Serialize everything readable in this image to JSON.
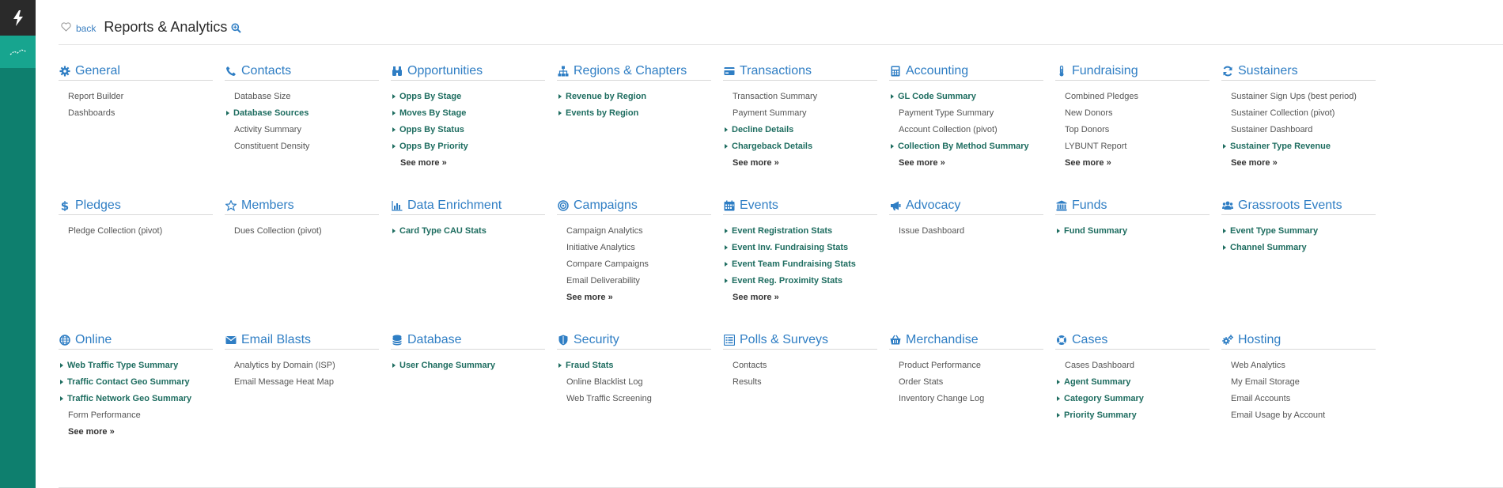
{
  "header": {
    "back_label": "back",
    "title": "Reports & Analytics"
  },
  "colors": {
    "rail": "#0e7f6e",
    "rail_active": "#17a58f",
    "accent": "#2f7ec4",
    "favorite": "#1e6d60"
  },
  "sections": [
    {
      "title": "General",
      "icon": "gear-icon",
      "items": [
        {
          "label": "Report Builder",
          "fav": false
        },
        {
          "label": "Dashboards",
          "fav": false
        }
      ],
      "see_more": ""
    },
    {
      "title": "Contacts",
      "icon": "phone-icon",
      "items": [
        {
          "label": "Database Size",
          "fav": false
        },
        {
          "label": "Database Sources",
          "fav": true
        },
        {
          "label": "Activity Summary",
          "fav": false
        },
        {
          "label": "Constituent Density",
          "fav": false
        }
      ],
      "see_more": ""
    },
    {
      "title": "Opportunities",
      "icon": "binoculars-icon",
      "items": [
        {
          "label": "Opps By Stage",
          "fav": true
        },
        {
          "label": "Moves By Stage",
          "fav": true
        },
        {
          "label": "Opps By Status",
          "fav": true
        },
        {
          "label": "Opps By Priority",
          "fav": true
        }
      ],
      "see_more": "See more »"
    },
    {
      "title": "Regions & Chapters",
      "icon": "sitemap-icon",
      "items": [
        {
          "label": "Revenue by Region",
          "fav": true
        },
        {
          "label": "Events by Region",
          "fav": true
        }
      ],
      "see_more": ""
    },
    {
      "title": "Transactions",
      "icon": "credit-card-icon",
      "items": [
        {
          "label": "Transaction Summary",
          "fav": false
        },
        {
          "label": "Payment Summary",
          "fav": false
        },
        {
          "label": "Decline Details",
          "fav": true
        },
        {
          "label": "Chargeback Details",
          "fav": true
        }
      ],
      "see_more": "See more »"
    },
    {
      "title": "Accounting",
      "icon": "calculator-icon",
      "items": [
        {
          "label": "GL Code Summary",
          "fav": true
        },
        {
          "label": "Payment Type Summary",
          "fav": false
        },
        {
          "label": "Account Collection (pivot)",
          "fav": false
        },
        {
          "label": "Collection By Method Summary",
          "fav": true
        }
      ],
      "see_more": "See more »"
    },
    {
      "title": "Fundraising",
      "icon": "thermometer-icon",
      "items": [
        {
          "label": "Combined Pledges",
          "fav": false
        },
        {
          "label": "New Donors",
          "fav": false
        },
        {
          "label": "Top Donors",
          "fav": false
        },
        {
          "label": "LYBUNT Report",
          "fav": false
        }
      ],
      "see_more": "See more »"
    },
    {
      "title": "Sustainers",
      "icon": "refresh-icon",
      "items": [
        {
          "label": "Sustainer Sign Ups (best period)",
          "fav": false
        },
        {
          "label": "Sustainer Collection (pivot)",
          "fav": false
        },
        {
          "label": "Sustainer Dashboard",
          "fav": false
        },
        {
          "label": "Sustainer Type Revenue",
          "fav": true
        }
      ],
      "see_more": "See more »"
    },
    {
      "title": "Pledges",
      "icon": "dollar-icon",
      "items": [
        {
          "label": "Pledge Collection (pivot)",
          "fav": false
        }
      ],
      "see_more": ""
    },
    {
      "title": "Members",
      "icon": "star-icon",
      "items": [
        {
          "label": "Dues Collection (pivot)",
          "fav": false
        }
      ],
      "see_more": ""
    },
    {
      "title": "Data Enrichment",
      "icon": "bar-chart-icon",
      "items": [
        {
          "label": "Card Type CAU Stats",
          "fav": true
        }
      ],
      "see_more": ""
    },
    {
      "title": "Campaigns",
      "icon": "bullseye-icon",
      "items": [
        {
          "label": "Campaign Analytics",
          "fav": false
        },
        {
          "label": "Initiative Analytics",
          "fav": false
        },
        {
          "label": "Compare Campaigns",
          "fav": false
        },
        {
          "label": "Email Deliverability",
          "fav": false
        }
      ],
      "see_more": "See more »"
    },
    {
      "title": "Events",
      "icon": "calendar-icon",
      "items": [
        {
          "label": "Event Registration Stats",
          "fav": true
        },
        {
          "label": "Event Inv. Fundraising Stats",
          "fav": true
        },
        {
          "label": "Event Team Fundraising Stats",
          "fav": true
        },
        {
          "label": "Event Reg. Proximity Stats",
          "fav": true
        }
      ],
      "see_more": "See more »"
    },
    {
      "title": "Advocacy",
      "icon": "bullhorn-icon",
      "items": [
        {
          "label": "Issue Dashboard",
          "fav": false
        }
      ],
      "see_more": ""
    },
    {
      "title": "Funds",
      "icon": "institution-icon",
      "items": [
        {
          "label": "Fund Summary",
          "fav": true
        }
      ],
      "see_more": ""
    },
    {
      "title": "Grassroots Events",
      "icon": "users-icon",
      "items": [
        {
          "label": "Event Type Summary",
          "fav": true
        },
        {
          "label": "Channel Summary",
          "fav": true
        }
      ],
      "see_more": ""
    },
    {
      "title": "Online",
      "icon": "globe-icon",
      "items": [
        {
          "label": "Web Traffic Type Summary",
          "fav": true
        },
        {
          "label": "Traffic Contact Geo Summary",
          "fav": true
        },
        {
          "label": "Traffic Network Geo Summary",
          "fav": true
        },
        {
          "label": "Form Performance",
          "fav": false
        }
      ],
      "see_more": "See more »"
    },
    {
      "title": "Email Blasts",
      "icon": "envelope-icon",
      "items": [
        {
          "label": "Analytics by Domain (ISP)",
          "fav": false
        },
        {
          "label": "Email Message Heat Map",
          "fav": false
        }
      ],
      "see_more": ""
    },
    {
      "title": "Database",
      "icon": "database-icon",
      "items": [
        {
          "label": "User Change Summary",
          "fav": true
        }
      ],
      "see_more": ""
    },
    {
      "title": "Security",
      "icon": "shield-icon",
      "items": [
        {
          "label": "Fraud Stats",
          "fav": true
        },
        {
          "label": "Online Blacklist Log",
          "fav": false
        },
        {
          "label": "Web Traffic Screening",
          "fav": false
        }
      ],
      "see_more": ""
    },
    {
      "title": "Polls & Surveys",
      "icon": "list-icon",
      "items": [
        {
          "label": "Contacts",
          "fav": false
        },
        {
          "label": "Results",
          "fav": false
        }
      ],
      "see_more": ""
    },
    {
      "title": "Merchandise",
      "icon": "basket-icon",
      "items": [
        {
          "label": "Product Performance",
          "fav": false
        },
        {
          "label": "Order Stats",
          "fav": false
        },
        {
          "label": "Inventory Change Log",
          "fav": false
        }
      ],
      "see_more": ""
    },
    {
      "title": "Cases",
      "icon": "life-ring-icon",
      "items": [
        {
          "label": "Cases Dashboard",
          "fav": false
        },
        {
          "label": "Agent Summary",
          "fav": true
        },
        {
          "label": "Category Summary",
          "fav": true
        },
        {
          "label": "Priority Summary",
          "fav": true
        }
      ],
      "see_more": ""
    },
    {
      "title": "Hosting",
      "icon": "cogs-icon",
      "items": [
        {
          "label": "Web Analytics",
          "fav": false
        },
        {
          "label": "My Email Storage",
          "fav": false
        },
        {
          "label": "Email Accounts",
          "fav": false
        },
        {
          "label": "Email Usage by Account",
          "fav": false
        }
      ],
      "see_more": ""
    }
  ]
}
